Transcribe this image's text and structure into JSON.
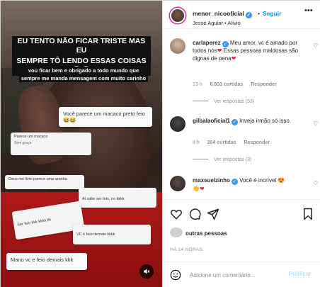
{
  "video": {
    "caption_line1": "EU TENTO NÃO FICAR TRISTE MAS EU",
    "caption_line2": "SEMPRE TÔ LENDO ESSAS COISAS",
    "caption_emoji": "😔😔",
    "subcaption_line1": "vou ficar bem e obrigado a todo mundo que",
    "subcaption_line2": "sempre me manda mensagem com muito carinho",
    "cards": [
      {
        "text": "Você parece um macaco preto feio 😂😂"
      },
      {
        "text": "Parece um macaco",
        "sub": "Sem graça"
      },
      {
        "text": "Deus me livre parece uma aranha"
      },
      {
        "text": "Ai sabe ser feio, no kkkk"
      },
      {
        "text": "Ser feio kkk kkkk kk"
      },
      {
        "text": "VC é feio demais kkkk"
      },
      {
        "text": "Mano vc e feio demais kkk"
      }
    ]
  },
  "header": {
    "username": "menor_nicooficial",
    "follow_label": "Seguir",
    "subtitle": "Jessé Aguiar • Alívio",
    "more": "•••"
  },
  "comments": [
    {
      "username": "carlaperez",
      "text_a": "Meu amor, vc é amado por todos nós",
      "text_b": " Essas pessoas maldosas são dignas de pena",
      "time": "13 h",
      "likes": "6.833 curtidas",
      "reply": "Responder",
      "replies": "Ver respostas (53)"
    },
    {
      "username": "gilbalaoficial1",
      "text_a": "Inveja irmão só isso.",
      "time": "8 h",
      "likes": "264 curtidas",
      "reply": "Responder",
      "replies": "Ver respostas (3)"
    },
    {
      "username": "maxsuelzinho",
      "text_a": "Você é incrível"
    }
  ],
  "likes_text": "outras pessoas",
  "timestamp": "HÁ 14 HORAS",
  "add_comment": {
    "placeholder": "Adicione um comentário...",
    "post_label": "Publicar"
  },
  "colors": {
    "accent": "#0095f6",
    "verified": "#3897f0",
    "heart": "#e0245e"
  }
}
